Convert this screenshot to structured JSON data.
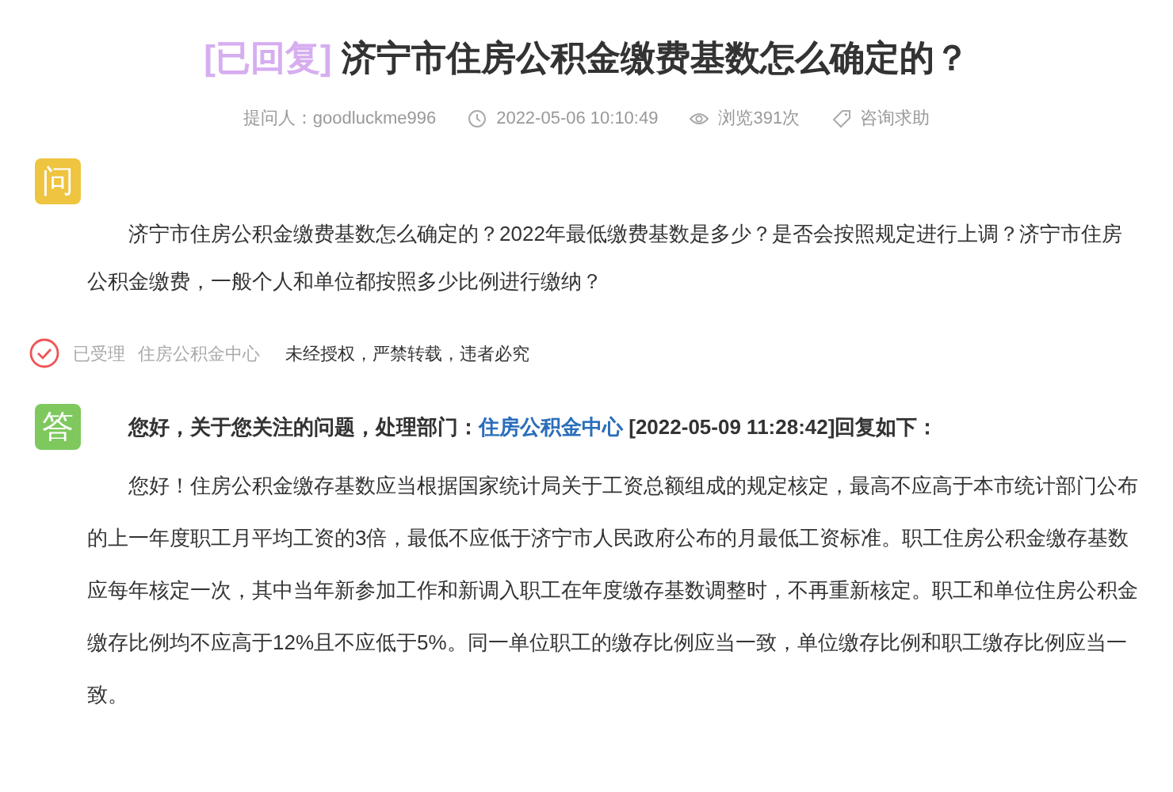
{
  "title": {
    "status": "[已回复]",
    "text": "济宁市住房公积金缴费基数怎么确定的？"
  },
  "meta": [
    {
      "kind": "asker",
      "text": "提问人：goodluckme996"
    },
    {
      "kind": "time",
      "text": "2022-05-06 10:10:49"
    },
    {
      "kind": "views",
      "text": "浏览391次"
    },
    {
      "kind": "category",
      "text": "咨询求助"
    }
  ],
  "question": {
    "badge": "问",
    "text": "济宁市住房公积金缴费基数怎么确定的？2022年最低缴费基数是多少？是否会按照规定进行上调？济宁市住房公积金缴费，一般个人和单位都按照多少比例进行缴纳？"
  },
  "status_row": {
    "state": "已受理",
    "department": "住房公积金中心",
    "notice": "未经授权，严禁转载，违者必究"
  },
  "answer": {
    "badge": "答",
    "heading_before": "您好，关于您关注的问题，处理部门：",
    "department": "住房公积金中心",
    "heading_after": "[2022-05-09 11:28:42]回复如下：",
    "text": "您好！住房公积金缴存基数应当根据国家统计局关于工资总额组成的规定核定，最高不应高于本市统计部门公布的上一年度职工月平均工资的3倍，最低不应低于济宁市人民政府公布的月最低工资标准。职工住房公积金缴存基数应每年核定一次，其中当年新参加工作和新调入职工在年度缴存基数调整时，不再重新核定。职工和单位住房公积金缴存比例均不应高于12%且不应低于5%。同一单位职工的缴存比例应当一致，单位缴存比例和职工缴存比例应当一致。"
  }
}
